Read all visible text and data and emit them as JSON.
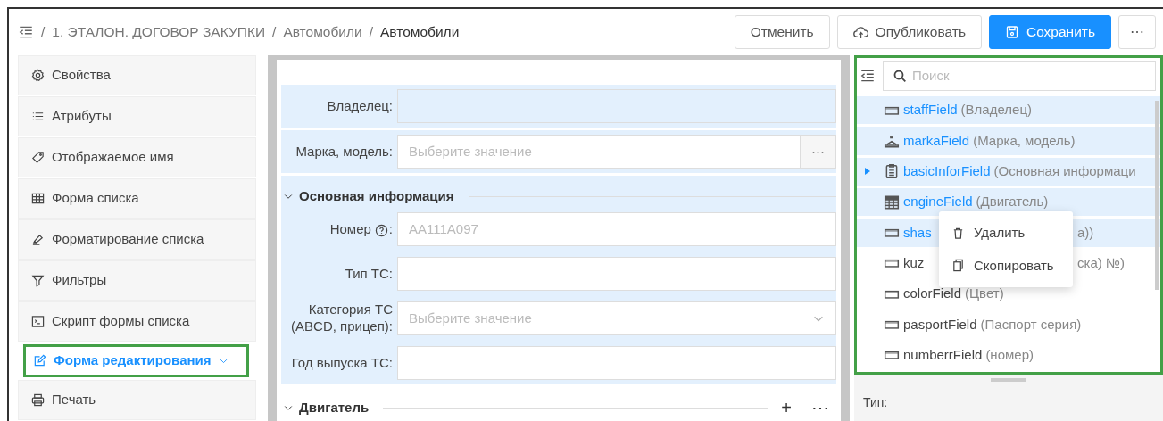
{
  "breadcrumb": [
    {
      "label": "1. ЭТАЛОН. ДОГОВОР ЗАКУПКИ",
      "current": false
    },
    {
      "label": "Автомобили",
      "current": false
    },
    {
      "label": "Автомобили",
      "current": true
    }
  ],
  "breadcrumb_separator": "/",
  "toolbar": [
    {
      "label": "Отменить",
      "kind": "plain"
    },
    {
      "label": "Опубликовать",
      "kind": "publish"
    },
    {
      "label": "Сохранить",
      "kind": "save"
    },
    {
      "label": "⋯",
      "kind": "more"
    }
  ],
  "sidebar": {
    "items": [
      {
        "label": "Свойства",
        "selected": false
      },
      {
        "label": "Атрибуты",
        "selected": false
      },
      {
        "label": "Отображаемое имя",
        "selected": false
      },
      {
        "label": "Форма списка",
        "selected": false
      },
      {
        "label": "Форматирование списка",
        "selected": false
      },
      {
        "label": "Фильтры",
        "selected": false
      },
      {
        "label": "Скрипт формы списка",
        "selected": false
      },
      {
        "label": "Форма редактирования",
        "selected": true
      },
      {
        "label": "Печать",
        "selected": false
      }
    ]
  },
  "form": {
    "blocks": [
      {
        "kind": "text",
        "label": "Владелец:",
        "readonly": true,
        "highlighted": true
      },
      {
        "kind": "lookup",
        "label": "Марка, модель:",
        "placeholder": "Выберите значение",
        "button": "⋯",
        "readonly": false,
        "highlighted": true
      },
      {
        "kind": "section",
        "title": "Основная информация",
        "expanded": true,
        "highlighted": true,
        "fields": [
          {
            "kind": "text",
            "label": "Номер",
            "help": true,
            "suffix": ":",
            "placeholder": "АА111А097",
            "readonly": false
          },
          {
            "kind": "text",
            "label": "Тип ТС:",
            "help": false,
            "readonly": false
          },
          {
            "kind": "select",
            "label": "Категория ТС (ABCD, прицеп):",
            "help": false,
            "placeholder": "Выберите значение",
            "readonly": false
          },
          {
            "kind": "text",
            "label": "Год выпуска ТС:",
            "help": false,
            "readonly": false
          }
        ]
      },
      {
        "kind": "section",
        "title": "Двигатель",
        "expanded": true,
        "highlighted": false,
        "actions": [
          "+",
          "⋯"
        ]
      }
    ]
  },
  "tree": {
    "search": {
      "placeholder": "Поиск"
    },
    "items": [
      {
        "kind": "text",
        "name": "staffField",
        "caption": "(Владелец)",
        "selected": true
      },
      {
        "kind": "lookup",
        "name": "markaField",
        "caption": "(Марка, модель)",
        "selected": true
      },
      {
        "kind": "group",
        "name": "basicInforField",
        "caption": "(Основная информаци",
        "selected": true,
        "expanded": false
      },
      {
        "kind": "table",
        "name": "engineField",
        "caption": "(Двигатель)",
        "selected": true
      },
      {
        "kind": "text",
        "name": "shas",
        "tail": "а))",
        "selected": true
      },
      {
        "kind": "text",
        "name": "kuz",
        "tail": "ска) №)",
        "selected": false
      },
      {
        "kind": "text",
        "name": "colorField",
        "caption": "(Цвет)",
        "selected": false
      },
      {
        "kind": "text",
        "name": "pasportField",
        "caption": "(Паспорт серия)",
        "selected": false
      },
      {
        "kind": "text",
        "name": "numberrField",
        "caption": "(номер)",
        "selected": false
      }
    ]
  },
  "context_menu": [
    {
      "label": "Удалить"
    },
    {
      "label": "Скопировать"
    }
  ],
  "properties": {
    "label": "Тип:"
  }
}
